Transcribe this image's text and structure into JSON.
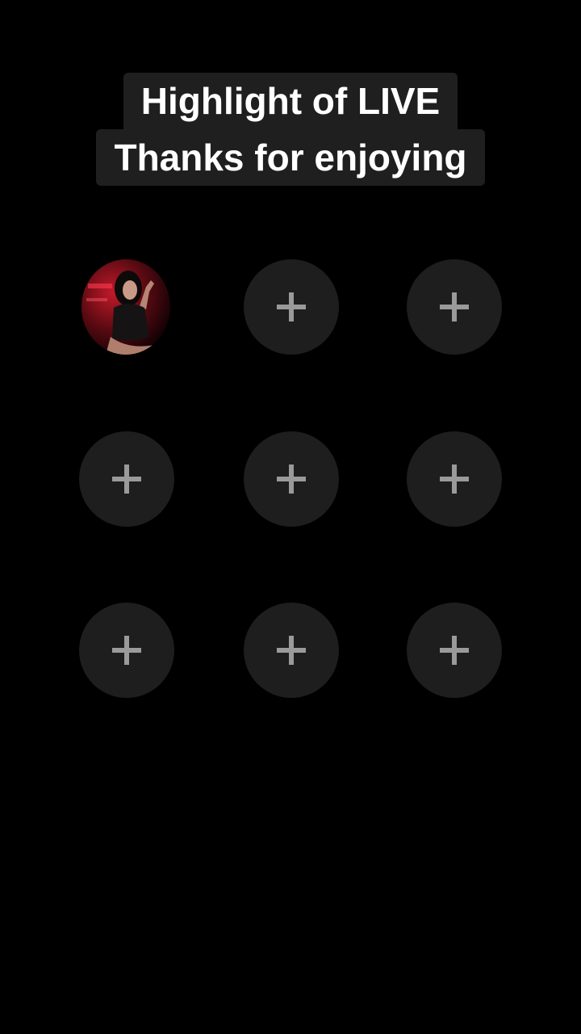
{
  "caption": {
    "line1": "Highlight of LIVE",
    "line2": "Thanks for enjoying"
  },
  "slots": [
    {
      "type": "avatar",
      "icon": "user-photo"
    },
    {
      "type": "add",
      "icon": "plus-icon"
    },
    {
      "type": "add",
      "icon": "plus-icon"
    },
    {
      "type": "add",
      "icon": "plus-icon"
    },
    {
      "type": "add",
      "icon": "plus-icon"
    },
    {
      "type": "add",
      "icon": "plus-icon"
    },
    {
      "type": "add",
      "icon": "plus-icon"
    },
    {
      "type": "add",
      "icon": "plus-icon"
    },
    {
      "type": "add",
      "icon": "plus-icon"
    }
  ],
  "colors": {
    "background": "#000000",
    "slot": "#1e1e1e",
    "plus": "#9a9a9a",
    "caption_bg": "#1f1f1f",
    "caption_text": "#ffffff"
  }
}
